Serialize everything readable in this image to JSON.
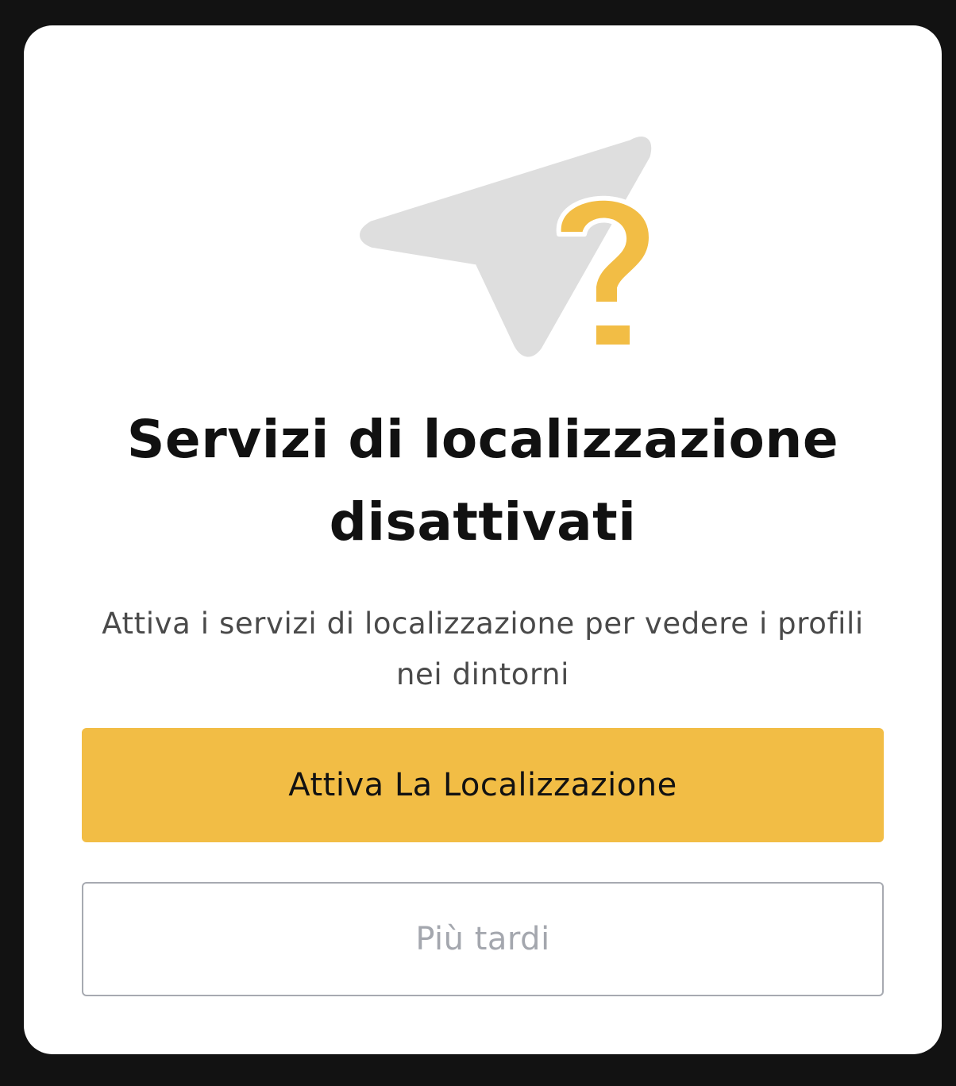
{
  "dialog": {
    "illustration": {
      "icon": "location-arrow-question-icon",
      "arrow_color": "#dedede",
      "question_color": "#f2bd45"
    },
    "title": "Servizi di localizzazione disattivati",
    "subtitle": "Attiva i servizi di localizzazione per vedere i profili nei dintorni",
    "primary_button_label": "Attiva La Localizzazione",
    "secondary_button_label": "Più tardi"
  },
  "colors": {
    "background": "#121212",
    "card": "#ffffff",
    "accent": "#f2bd45",
    "title_text": "#111111",
    "subtitle_text": "#4a4a4a",
    "secondary_text": "#a4a7ae"
  }
}
